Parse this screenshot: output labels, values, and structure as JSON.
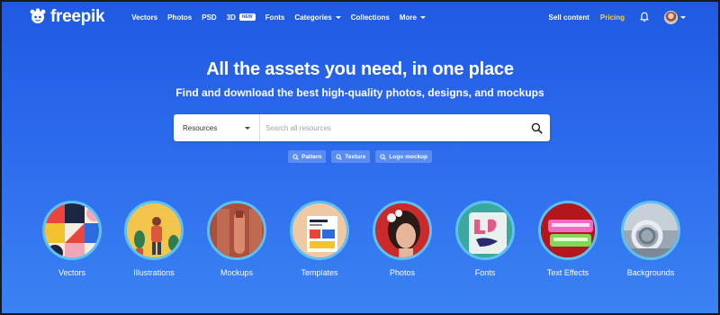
{
  "nav": {
    "logo_text": "freepik",
    "items": [
      {
        "label": "Vectors"
      },
      {
        "label": "Photos"
      },
      {
        "label": "PSD"
      },
      {
        "label": "3D",
        "badge": "NEW"
      },
      {
        "label": "Fonts"
      },
      {
        "label": "Categories"
      },
      {
        "label": "Collections"
      },
      {
        "label": "More"
      }
    ],
    "sell_label": "Sell content",
    "pricing_label": "Pricing",
    "pricing_color": "#f5cf5b"
  },
  "hero": {
    "title": "All the assets you need, in one place",
    "subtitle": "Find and download the best high-quality photos, designs, and mockups"
  },
  "search": {
    "select_value": "Resources",
    "placeholder": "Search all resources",
    "value": ""
  },
  "tags": [
    {
      "label": "Pattern"
    },
    {
      "label": "Texture"
    },
    {
      "label": "Logo mockup"
    }
  ],
  "categories": [
    {
      "label": "Vectors"
    },
    {
      "label": "Illustrations"
    },
    {
      "label": "Mockups"
    },
    {
      "label": "Templates"
    },
    {
      "label": "Photos"
    },
    {
      "label": "Fonts"
    },
    {
      "label": "Text Effects"
    },
    {
      "label": "Backgrounds"
    }
  ],
  "colors": {
    "background_top": "#1f5ae0",
    "background_bottom": "#3b82f2",
    "circle_ring": "#5ec0f5"
  }
}
